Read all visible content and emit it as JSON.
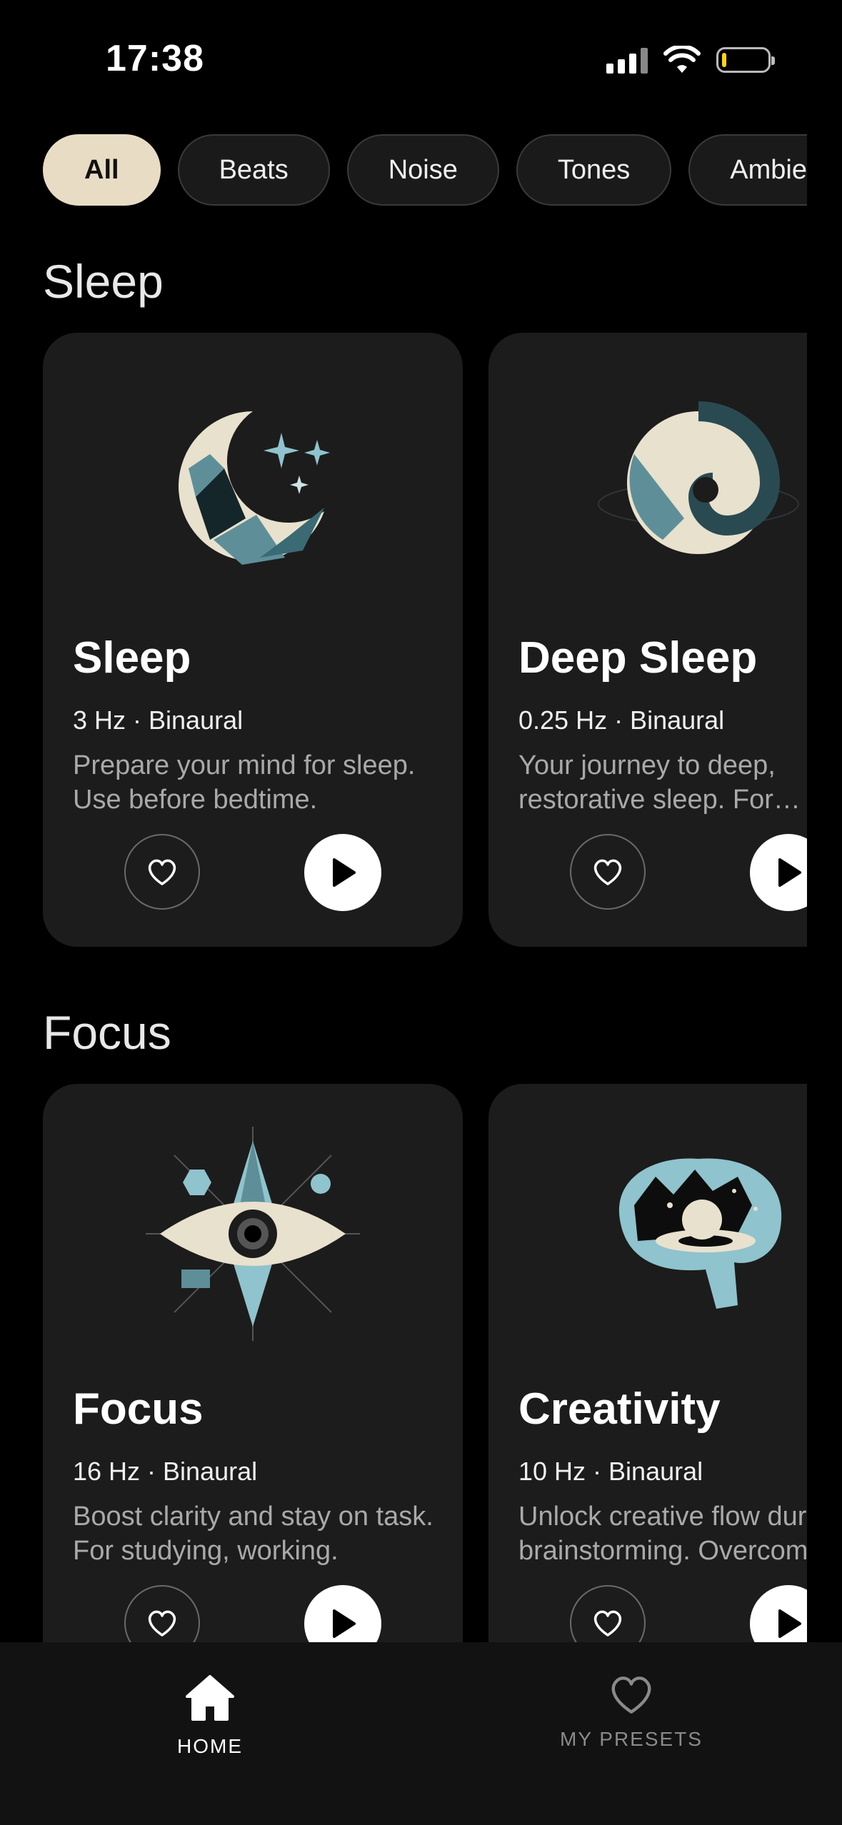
{
  "status": {
    "time": "17:38"
  },
  "filters": [
    "All",
    "Beats",
    "Noise",
    "Tones",
    "Ambient"
  ],
  "sections": [
    {
      "title": "Sleep",
      "cards": [
        {
          "title": "Sleep",
          "meta": "3 Hz · Binaural",
          "desc": "Prepare your mind for sleep. Use before bedtime."
        },
        {
          "title": "Deep Sleep",
          "meta": "0.25 Hz · Binaural",
          "desc": "Your journey to deep, restorative sleep. For insomnia."
        }
      ]
    },
    {
      "title": "Focus",
      "cards": [
        {
          "title": "Focus",
          "meta": "16 Hz · Binaural",
          "desc": "Boost clarity and stay on task. For studying, working."
        },
        {
          "title": "Creativity",
          "meta": "10 Hz · Binaural",
          "desc": "Unlock creative flow during brainstorming. Overcome blocks."
        }
      ]
    }
  ],
  "tabs": {
    "home": "HOME",
    "presets": "MY PRESETS"
  },
  "colors": {
    "accent": "#e8dcc5",
    "card": "#1c1c1c",
    "teal": "#5e8f99"
  }
}
